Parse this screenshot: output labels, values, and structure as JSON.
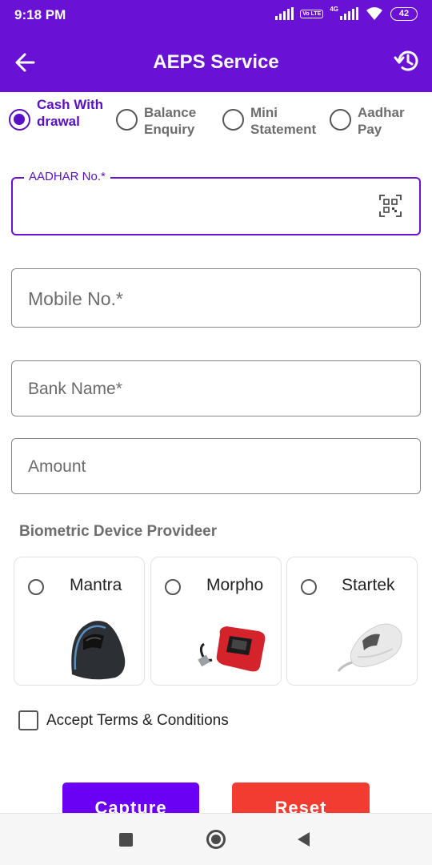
{
  "status_bar": {
    "time": "9:18 PM",
    "volte": "Vo LTE",
    "network": "4G",
    "battery": "42",
    "icons": [
      "signal-icon",
      "volte-icon",
      "signal-4g-icon",
      "wifi-icon",
      "battery-icon"
    ]
  },
  "app_bar": {
    "title": "AEPS Service",
    "back_icon": "arrow-left-icon",
    "history_icon": "history-icon"
  },
  "services": [
    {
      "label": "Cash Withdrawal",
      "selected": true
    },
    {
      "label_line1": "Balance",
      "label_line2": "Enquiry",
      "selected": false
    },
    {
      "label_line1": "Mini",
      "label_line2": "Statement",
      "selected": false
    },
    {
      "label_line1": "Aadhar",
      "label_line2": "Pay",
      "selected": false
    }
  ],
  "form": {
    "aadhar_label": "AADHAR No.*",
    "aadhar_value": "",
    "mobile_placeholder": "Mobile No.*",
    "bank_placeholder": "Bank Name*",
    "amount_placeholder": "Amount"
  },
  "biometric": {
    "section_title": "Biometric Device Provideer",
    "devices": [
      {
        "name": "Mantra",
        "selected": false
      },
      {
        "name": "Morpho",
        "selected": false
      },
      {
        "name": "Startek",
        "selected": false
      }
    ]
  },
  "terms": {
    "label": "Accept Terms & Conditions",
    "checked": false
  },
  "buttons": {
    "capture": "Capture",
    "reset": "Reset"
  },
  "colors": {
    "primary": "#6a11d6",
    "capture": "#6a00f4",
    "reset": "#f23c32"
  }
}
